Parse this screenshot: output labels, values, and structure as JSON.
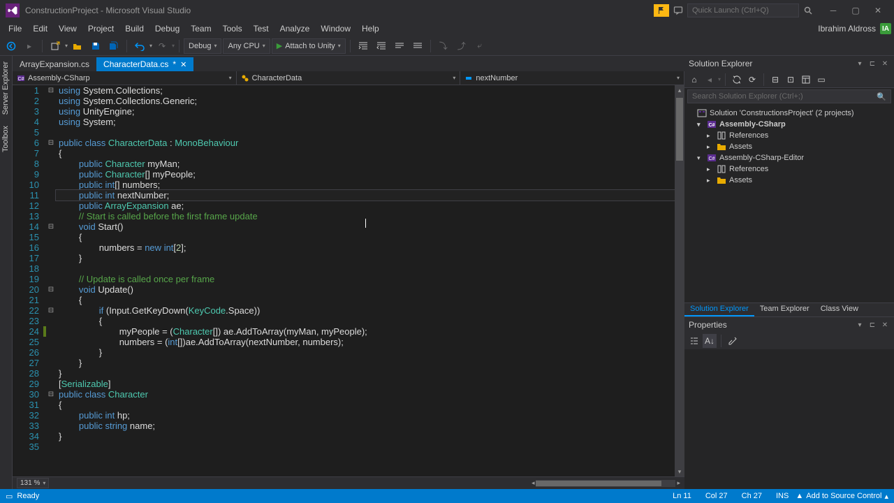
{
  "title": "ConstructionProject - Microsoft Visual Studio",
  "quick_launch_placeholder": "Quick Launch (Ctrl+Q)",
  "menu": [
    "File",
    "Edit",
    "View",
    "Project",
    "Build",
    "Debug",
    "Team",
    "Tools",
    "Test",
    "Analyze",
    "Window",
    "Help"
  ],
  "user": {
    "name": "Ibrahim Aldross",
    "initials": "IA"
  },
  "toolbar": {
    "config": "Debug",
    "platform": "Any CPU",
    "attach": "Attach to Unity"
  },
  "tabs": [
    {
      "name": "ArrayExpansion.cs",
      "active": false
    },
    {
      "name": "CharacterData.cs",
      "active": true,
      "dirty": true
    }
  ],
  "nav": {
    "project": "Assembly-CSharp",
    "class": "CharacterData",
    "member": "nextNumber"
  },
  "code": [
    {
      "n": 1,
      "fold": "-",
      "tokens": [
        [
          "k",
          "using"
        ],
        [
          "p",
          " "
        ],
        [
          "p",
          "System"
        ],
        [
          "p",
          "."
        ],
        [
          "p",
          "Collections"
        ],
        [
          "p",
          ";"
        ]
      ]
    },
    {
      "n": 2,
      "tokens": [
        [
          "k",
          "using"
        ],
        [
          "p",
          " "
        ],
        [
          "p",
          "System"
        ],
        [
          "p",
          "."
        ],
        [
          "p",
          "Collections"
        ],
        [
          "p",
          "."
        ],
        [
          "p",
          "Generic"
        ],
        [
          "p",
          ";"
        ]
      ]
    },
    {
      "n": 3,
      "tokens": [
        [
          "k",
          "using"
        ],
        [
          "p",
          " "
        ],
        [
          "p",
          "UnityEngine"
        ],
        [
          "p",
          ";"
        ]
      ]
    },
    {
      "n": 4,
      "tokens": [
        [
          "k",
          "using"
        ],
        [
          "p",
          " "
        ],
        [
          "p",
          "System"
        ],
        [
          "p",
          ";"
        ]
      ]
    },
    {
      "n": 5,
      "tokens": []
    },
    {
      "n": 6,
      "fold": "-",
      "tokens": [
        [
          "k",
          "public"
        ],
        [
          "p",
          " "
        ],
        [
          "k",
          "class"
        ],
        [
          "p",
          " "
        ],
        [
          "t",
          "CharacterData"
        ],
        [
          "p",
          " : "
        ],
        [
          "t",
          "MonoBehaviour"
        ]
      ]
    },
    {
      "n": 7,
      "tokens": [
        [
          "p",
          "{"
        ]
      ]
    },
    {
      "n": 8,
      "indent": 2,
      "tokens": [
        [
          "k",
          "public"
        ],
        [
          "p",
          " "
        ],
        [
          "t",
          "Character"
        ],
        [
          "p",
          " myMan;"
        ]
      ]
    },
    {
      "n": 9,
      "indent": 2,
      "tokens": [
        [
          "k",
          "public"
        ],
        [
          "p",
          " "
        ],
        [
          "t",
          "Character"
        ],
        [
          "p",
          "[] myPeople;"
        ]
      ]
    },
    {
      "n": 10,
      "indent": 2,
      "tokens": [
        [
          "k",
          "public"
        ],
        [
          "p",
          " "
        ],
        [
          "k",
          "int"
        ],
        [
          "p",
          "[] numbers;"
        ]
      ]
    },
    {
      "n": 11,
      "indent": 2,
      "current": true,
      "tokens": [
        [
          "k",
          "public"
        ],
        [
          "p",
          " "
        ],
        [
          "k",
          "int"
        ],
        [
          "p",
          " nextNumber;"
        ]
      ]
    },
    {
      "n": 12,
      "indent": 2,
      "tokens": [
        [
          "k",
          "public"
        ],
        [
          "p",
          " "
        ],
        [
          "t",
          "ArrayExpansion"
        ],
        [
          "p",
          " ae;"
        ]
      ]
    },
    {
      "n": 13,
      "indent": 2,
      "tokens": [
        [
          "c",
          "// Start is called before the first frame update"
        ]
      ]
    },
    {
      "n": 14,
      "fold": "-",
      "indent": 2,
      "tokens": [
        [
          "k",
          "void"
        ],
        [
          "p",
          " Start()"
        ]
      ]
    },
    {
      "n": 15,
      "indent": 2,
      "tokens": [
        [
          "p",
          "{"
        ]
      ]
    },
    {
      "n": 16,
      "indent": 4,
      "tokens": [
        [
          "p",
          "numbers = "
        ],
        [
          "k",
          "new"
        ],
        [
          "p",
          " "
        ],
        [
          "k",
          "int"
        ],
        [
          "p",
          "["
        ],
        [
          "n",
          "2"
        ],
        [
          "p",
          "];"
        ]
      ]
    },
    {
      "n": 17,
      "indent": 2,
      "tokens": [
        [
          "p",
          "}"
        ]
      ]
    },
    {
      "n": 18,
      "tokens": []
    },
    {
      "n": 19,
      "indent": 2,
      "tokens": [
        [
          "c",
          "// Update is called once per frame"
        ]
      ]
    },
    {
      "n": 20,
      "fold": "-",
      "indent": 2,
      "tokens": [
        [
          "k",
          "void"
        ],
        [
          "p",
          " Update()"
        ]
      ]
    },
    {
      "n": 21,
      "indent": 2,
      "tokens": [
        [
          "p",
          "{"
        ]
      ]
    },
    {
      "n": 22,
      "fold": "-",
      "indent": 4,
      "tokens": [
        [
          "k",
          "if"
        ],
        [
          "p",
          " (Input.GetKeyDown("
        ],
        [
          "t",
          "KeyCode"
        ],
        [
          "p",
          ".Space))"
        ]
      ]
    },
    {
      "n": 23,
      "indent": 4,
      "tokens": [
        [
          "p",
          "{"
        ]
      ]
    },
    {
      "n": 24,
      "indent": 6,
      "changed": true,
      "tokens": [
        [
          "p",
          "myPeople = ("
        ],
        [
          "t",
          "Character"
        ],
        [
          "p",
          "[]) ae.AddToArray(myMan, myPeople);"
        ]
      ]
    },
    {
      "n": 25,
      "indent": 6,
      "tokens": [
        [
          "p",
          "numbers = ("
        ],
        [
          "k",
          "int"
        ],
        [
          "p",
          "[])ae.AddToArray(nextNumber, numbers);"
        ]
      ]
    },
    {
      "n": 26,
      "indent": 4,
      "tokens": [
        [
          "p",
          "}"
        ]
      ]
    },
    {
      "n": 27,
      "indent": 2,
      "tokens": [
        [
          "p",
          "}"
        ]
      ]
    },
    {
      "n": 28,
      "tokens": [
        [
          "p",
          "}"
        ]
      ]
    },
    {
      "n": 29,
      "tokens": [
        [
          "p",
          "["
        ],
        [
          "t",
          "Serializable"
        ],
        [
          "p",
          "]"
        ]
      ]
    },
    {
      "n": 30,
      "fold": "-",
      "tokens": [
        [
          "k",
          "public"
        ],
        [
          "p",
          " "
        ],
        [
          "k",
          "class"
        ],
        [
          "p",
          " "
        ],
        [
          "t",
          "Character"
        ]
      ]
    },
    {
      "n": 31,
      "tokens": [
        [
          "p",
          "{"
        ]
      ]
    },
    {
      "n": 32,
      "indent": 2,
      "tokens": [
        [
          "k",
          "public"
        ],
        [
          "p",
          " "
        ],
        [
          "k",
          "int"
        ],
        [
          "p",
          " hp;"
        ]
      ]
    },
    {
      "n": 33,
      "indent": 2,
      "tokens": [
        [
          "k",
          "public"
        ],
        [
          "p",
          " "
        ],
        [
          "k",
          "string"
        ],
        [
          "p",
          " name;"
        ]
      ]
    },
    {
      "n": 34,
      "tokens": [
        [
          "p",
          "}"
        ]
      ]
    },
    {
      "n": 35,
      "tokens": []
    }
  ],
  "zoom": "131 %",
  "solution_explorer": {
    "title": "Solution Explorer",
    "search_placeholder": "Search Solution Explorer (Ctrl+;)",
    "root": "Solution 'ConstructionsProject' (2 projects)",
    "nodes": [
      {
        "depth": 1,
        "arrow": "▾",
        "icon": "csproj",
        "label": "Assembly-CSharp",
        "bold": true
      },
      {
        "depth": 2,
        "arrow": "▸",
        "icon": "ref",
        "label": "References"
      },
      {
        "depth": 2,
        "arrow": "▸",
        "icon": "folder",
        "label": "Assets"
      },
      {
        "depth": 1,
        "arrow": "▾",
        "icon": "csproj",
        "label": "Assembly-CSharp-Editor"
      },
      {
        "depth": 2,
        "arrow": "▸",
        "icon": "ref",
        "label": "References"
      },
      {
        "depth": 2,
        "arrow": "▸",
        "icon": "folder",
        "label": "Assets"
      }
    ],
    "tabs": [
      "Solution Explorer",
      "Team Explorer",
      "Class View"
    ]
  },
  "properties": {
    "title": "Properties"
  },
  "status": {
    "ready": "Ready",
    "ln": "Ln 11",
    "col": "Col 27",
    "ch": "Ch 27",
    "ins": "INS",
    "add_source": "Add to Source Control"
  },
  "side_tabs": [
    "Server Explorer",
    "Toolbox"
  ]
}
